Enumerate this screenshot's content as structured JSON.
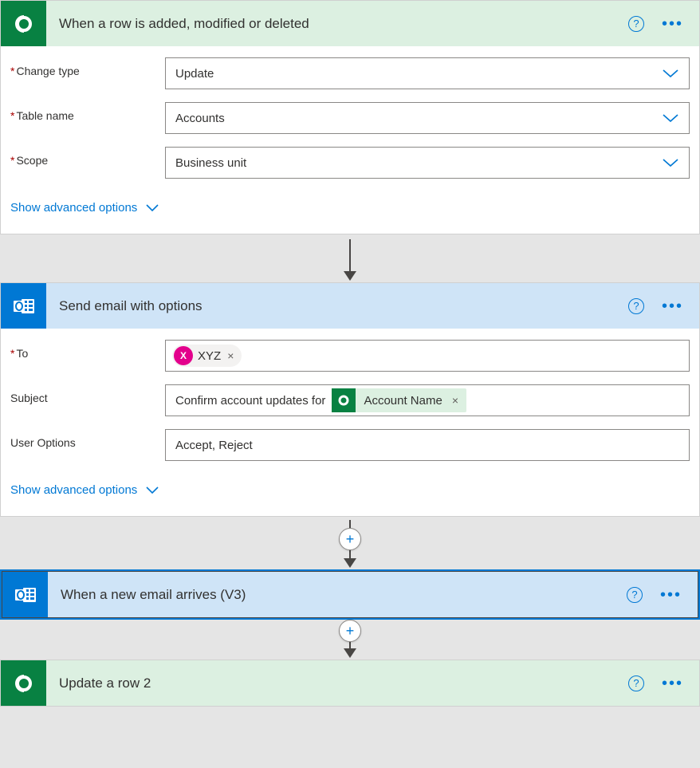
{
  "cards": {
    "trigger": {
      "title": "When a row is added, modified or deleted",
      "fields": {
        "change_type": {
          "label": "Change type",
          "value": "Update"
        },
        "table_name": {
          "label": "Table name",
          "value": "Accounts"
        },
        "scope": {
          "label": "Scope",
          "value": "Business unit"
        }
      },
      "advanced_link": "Show advanced options"
    },
    "send_email": {
      "title": "Send email with options",
      "fields": {
        "to": {
          "label": "To",
          "token_initial": "X",
          "token_text": "XYZ"
        },
        "subject": {
          "label": "Subject",
          "prefix_text": "Confirm account updates for ",
          "token_text": "Account Name"
        },
        "user_options": {
          "label": "User Options",
          "value": "Accept, Reject"
        }
      },
      "advanced_link": "Show advanced options"
    },
    "new_email": {
      "title": "When a new email arrives (V3)"
    },
    "update_row": {
      "title": "Update a row 2"
    }
  },
  "icons": {
    "help_char": "?",
    "more_char": "•••",
    "remove_char": "×",
    "plus_char": "+"
  }
}
